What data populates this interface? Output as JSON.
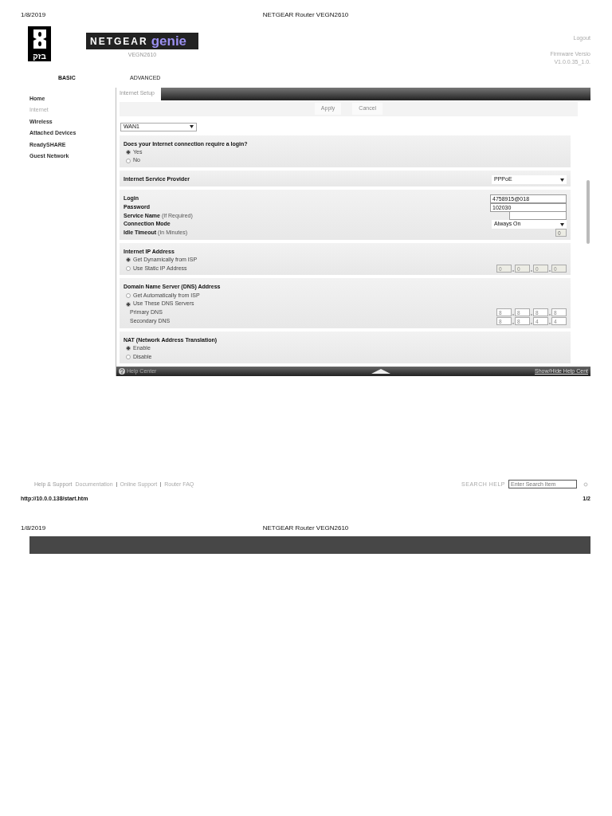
{
  "print_header": {
    "date": "1/8/2019",
    "title": "NETGEAR Router VEGN2610"
  },
  "brand": {
    "operator_logo_text": "בזק",
    "product": "NETGEAR",
    "product_suffix": "genie",
    "model": "VEGN2610",
    "logout": "Logout",
    "firmware_label": "Firmware Versio",
    "firmware_value": "V1.0.0.35_1.0."
  },
  "top_tabs": [
    {
      "label": "BASIC",
      "selected": true
    },
    {
      "label": "ADVANCED",
      "selected": false
    }
  ],
  "sidebar": {
    "items": [
      {
        "label": "Home",
        "selected": false
      },
      {
        "label": "Internet",
        "selected": true
      },
      {
        "label": "Wireless",
        "selected": false
      },
      {
        "label": "Attached Devices",
        "selected": false
      },
      {
        "label": "ReadySHARE",
        "selected": false
      },
      {
        "label": "Guest Network",
        "selected": false
      }
    ]
  },
  "panel": {
    "tab": "Internet Setup",
    "buttons": [
      "Apply",
      "Cancel"
    ],
    "wan_select": "WAN1",
    "sections": [
      {
        "title": "Does your Internet connection require a login?",
        "rows": [
          {
            "kind": "radio",
            "label": "Yes",
            "selected": true
          },
          {
            "kind": "radio",
            "label": "No",
            "selected": false
          }
        ]
      },
      {
        "rows": [
          {
            "kind": "select",
            "label": "Internet Service Provider",
            "value": "PPPoE"
          }
        ]
      },
      {
        "rows": [
          {
            "kind": "text",
            "label": "Login",
            "value": "4758915@018"
          },
          {
            "kind": "text",
            "label": "Password",
            "value": "102030"
          },
          {
            "kind": "short",
            "label": "Service Name",
            "note": "(If Required)"
          },
          {
            "kind": "select",
            "label": "Connection Mode",
            "value": "Always On"
          },
          {
            "kind": "tiny",
            "label": "Idle Timeout",
            "note": "(In Minutes)",
            "value": "0",
            "disabled": true
          }
        ]
      },
      {
        "title": "Internet IP Address",
        "rows": [
          {
            "kind": "radio",
            "label": "Get Dynamically from ISP",
            "selected": true
          },
          {
            "kind": "radio",
            "label": "Use Static IP Address",
            "selected": false,
            "ip": [
              "0",
              "0",
              "0",
              "0"
            ],
            "disabled": true
          }
        ]
      },
      {
        "title": "Domain Name Server (DNS) Address",
        "rows": [
          {
            "kind": "radio",
            "label": "Get Automatically from ISP",
            "selected": false
          },
          {
            "kind": "radio",
            "label": "Use These DNS Servers",
            "selected": true
          },
          {
            "kind": "ip",
            "label": "Primary DNS",
            "ip": [
              "8",
              "8",
              "8",
              "8"
            ]
          },
          {
            "kind": "ip",
            "label": "Secondary DNS",
            "ip": [
              "8",
              "8",
              "4",
              "4"
            ]
          }
        ]
      },
      {
        "title": "NAT (Network Address Translation)",
        "rows": [
          {
            "kind": "radio",
            "label": "Enable",
            "selected": true
          },
          {
            "kind": "radio",
            "label": "Disable",
            "selected": false
          }
        ]
      }
    ],
    "help_center": "Help Center",
    "help_toggle": "Show/Hide Help Cent"
  },
  "support": {
    "title": "Help & Support",
    "links": [
      "Documentation",
      "Online Support",
      "Router FAQ"
    ],
    "search_label": "SEARCH HELP",
    "search_placeholder": "Enter Search Item"
  },
  "print_footer": {
    "url": "http://10.0.0.138/start.htm",
    "page": "1/2"
  },
  "page2_header": {
    "date": "1/8/2019",
    "title": "NETGEAR Router VEGN2610"
  }
}
